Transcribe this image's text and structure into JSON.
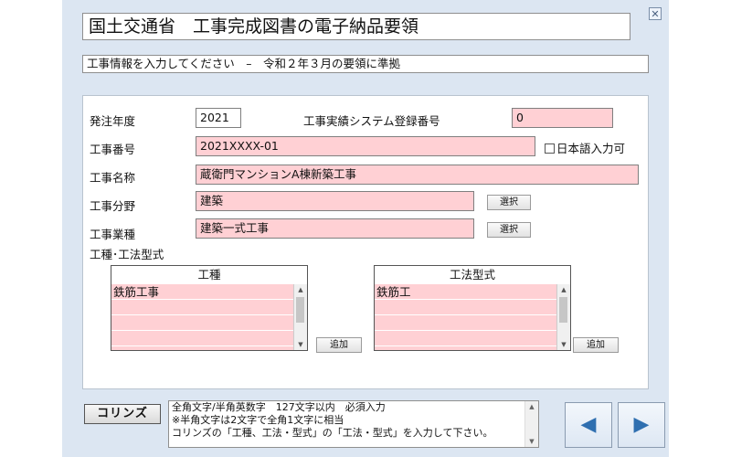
{
  "window": {
    "title": "国土交通省　工事完成図書の電子納品要領",
    "subtitle": "工事情報を入力してください　–　令和２年３月の要領に準拠",
    "close_glyph": "✕"
  },
  "form": {
    "order_year": {
      "label": "発注年度",
      "value": "2021"
    },
    "registration_no": {
      "label": "工事実績システム登録番号",
      "value": "0"
    },
    "work_no": {
      "label": "工事番号",
      "value": "2021XXXX-01"
    },
    "japanese_input": {
      "label": "日本語入力可",
      "checked": false
    },
    "work_name": {
      "label": "工事名称",
      "value": "蔵衛門マンションA棟新築工事"
    },
    "work_field": {
      "label": "工事分野",
      "value": "建築",
      "button": "選択"
    },
    "work_type": {
      "label": "工事業種",
      "value": "建築一式工事",
      "button": "選択"
    },
    "section_label": "工種･工法型式",
    "kosyu_list": {
      "header": "工種",
      "items": [
        "鉄筋工事",
        "",
        "",
        ""
      ],
      "add_button": "追加"
    },
    "koho_list": {
      "header": "工法型式",
      "items": [
        "鉄筋工",
        "",
        "",
        ""
      ],
      "add_button": "追加"
    }
  },
  "footer": {
    "corins_button": "コリンズ",
    "help_lines": [
      "全角文字/半角英数字　127文字以内　必須入力",
      "※半角文字は2文字で全角1文字に相当",
      "コリンズの「工種、工法・型式」の「工法・型式」を入力して下さい。"
    ],
    "prev_glyph": "◀",
    "next_glyph": "▶"
  },
  "colors": {
    "window_bg": "#dce6f2",
    "required_field": "#ffd0d4",
    "nav_arrow": "#2f6fb0"
  },
  "icons": {
    "close": "close-icon",
    "prev": "triangle-left-icon",
    "next": "triangle-right-icon",
    "scroll_up": "scroll-up-arrow-icon",
    "scroll_down": "scroll-down-arrow-icon"
  }
}
